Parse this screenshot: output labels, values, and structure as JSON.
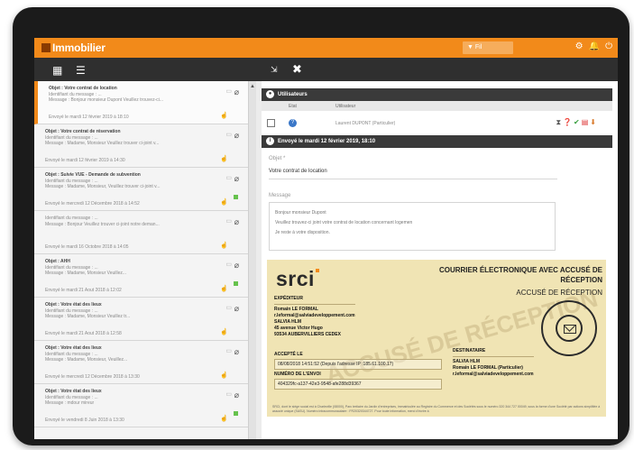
{
  "app": {
    "title": "Immobilier",
    "filter_label": "Fil"
  },
  "top_icons": [
    "gear-icon",
    "bell-icon",
    "power-icon"
  ],
  "toolbar": {
    "icons": [
      "calendar-icon",
      "list-icon",
      "collapse-icon",
      "expand-icon"
    ]
  },
  "messages": [
    {
      "title": "Objet : Votre contrat de location",
      "line1": "Identifiant du message : ...",
      "line2": "Message : Bonjour monsieur Dupont Veuillez trouvez-ci...",
      "date": "Envoyé le mardi 12 février 2019 à 18:10",
      "flag": false,
      "active": true
    },
    {
      "title": "Objet : Votre contrat de réservation",
      "line1": "Identifiant du message : ...",
      "line2": "Message : Madame, Monsieur Veuillez trouver ci-joint v...",
      "date": "Envoyé le mardi 12 février 2019 à 14:30",
      "flag": false
    },
    {
      "title": "Objet : Suivie VUE - Demande de subvention",
      "line1": "Identifiant du message : ...",
      "line2": "Message : Madame, Monsieur, Veuillez trouver ci-joint v...",
      "date": "Envoyé le mercredi 12 Décembre 2018 à 14:52",
      "flag": true
    },
    {
      "title": "",
      "line1": "Identifiant du message : ...",
      "line2": "Message : Bonjour Veuillez trouver ci-joint notre deman...",
      "date": "Envoyé le mardi 16 Octobre 2018 à 14:05",
      "flag": false
    },
    {
      "title": "Objet : AHH",
      "line1": "Identifiant du message : ...",
      "line2": "Message : Madame, Monsieur Veuillez...",
      "date": "Envoyé le mardi 21 Aout 2018 à 12:02",
      "flag": true
    },
    {
      "title": "Objet : Votre état des lieux",
      "line1": "Identifiant du message : ...",
      "line2": "Message : Madame, Monsieur Veuillez tr...",
      "date": "Envoyé le mardi 21 Aout 2018 à 12:58",
      "flag": false
    },
    {
      "title": "Objet : Votre état des lieux",
      "line1": "Identifiant du message : ...",
      "line2": "Message : Madame, Monsieur, Veuillez...",
      "date": "Envoyé le mercredi 12 Décembre 2018 à 13:30",
      "flag": false
    },
    {
      "title": "Objet : Votre état des lieux",
      "line1": "Identifiant du message : ...",
      "line2": "Message : mdour mireur",
      "date": "Envoyé le vendredi 8 Juin 2018 à 13:30",
      "flag": true
    }
  ],
  "users_section": {
    "title": "Utilisateurs",
    "col_etat": "Etat",
    "col_user": "Utilisateur",
    "user_name": "Laurent DUPONT (Particulier)",
    "action_icons": [
      "hourglass-icon",
      "help-icon",
      "check-icon",
      "pdf-icon",
      "download-icon"
    ]
  },
  "sent_section": {
    "title": "Envoyé le mardi 12 février 2019, 18:10"
  },
  "form": {
    "object_label": "Objet *",
    "object_value": "Votre contrat de location",
    "message_label": "Message",
    "message_lines": [
      "Bonjour monsieur Dupont",
      "Veuillez trouvez-ci joint votre contrat de location concernant logemen",
      "Je reste à votre disposition."
    ]
  },
  "receipt": {
    "brand": "srci",
    "title_line1": "COURRIER ÉLECTRONIQUE AVEC ACCUSÉ DE",
    "title_line2": "RÉCEPTION",
    "subtitle": "ACCUSÉ DE RÉCEPTION",
    "watermark": "ACCUSÉ DE RÉCEPTION",
    "sender_label": "EXPÉDITEUR",
    "sender_lines": [
      "Romain LE FORMAL",
      "r.leformal@salviadeveloppement.com",
      "SALVIA HLM",
      "45 avenue Victor Hugo",
      "93534 AUBERVILLIERS CEDEX"
    ],
    "accepted_label": "ACCEPTÉ LE",
    "accepted_value": "08/08/2018 14:51:52 (Depuis l'adresse IP :185.61.100.17)",
    "number_label": "NUMÉRO DE L'ENVOI",
    "number_value": "404329fc-a137-42e3-9548-afe288d39367",
    "recipient_label": "DESTINATAIRE",
    "recipient_lines": [
      "SALVIA HLM",
      "Romain LE FORMAL (Particulier)",
      "r.leformal@salviadeveloppement.com"
    ],
    "footer": "SRCI, dont le siège social est à Charleville (08000), Parc tertiaire du Jardin d'entreprises, immatriculée au Registre du Commerce et des Sociétés sous le numéro 320 344 727 00049, sous la forme d'une Société par actions simplifiée à associé unique (SASU). Numéro intracommunautaire : FR20320344727. Pour toute information, merci d'écrire à"
  }
}
